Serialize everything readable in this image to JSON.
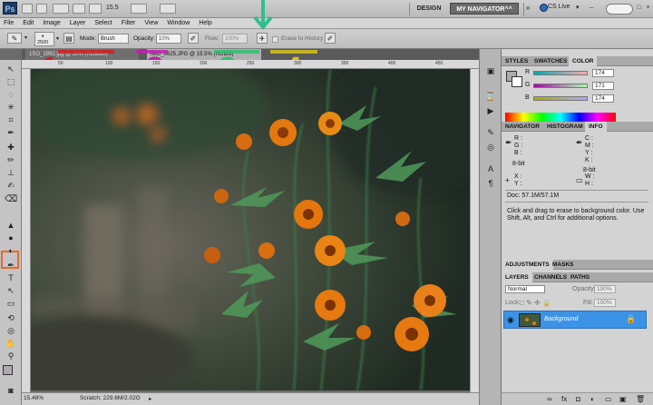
{
  "app": {
    "logo": "Ps",
    "zoom": "15.5",
    "workspace_design": "DESIGN",
    "workspace_active": "MY NAVIGATOR^^",
    "cs_live": "CS Live",
    "win_min": "–",
    "win_max": "□",
    "win_close": "×"
  },
  "menu": [
    "File",
    "Edit",
    "Image",
    "Layer",
    "Select",
    "Filter",
    "View",
    "Window",
    "Help"
  ],
  "options": {
    "brush_size": "2500",
    "mode_label": "Mode:",
    "mode_value": "Brush",
    "opacity_label": "Opacity:",
    "opacity_value": "10%",
    "flow_label": "Flow:",
    "flow_value": "100%",
    "erase_history_label": "Erase to History"
  },
  "tabs": [
    {
      "label": "1SO_1992.jpg @ 50% (RGB/8#)"
    },
    {
      "label": "IMG_0625.JPG @ 15.5% (RGB/8)"
    }
  ],
  "ruler": [
    "50",
    "100",
    "150",
    "200",
    "250",
    "300",
    "350",
    "400",
    "450"
  ],
  "annotations": {
    "n1": {
      "text": "1",
      "color": "#d11f1f"
    },
    "n2": {
      "text": "2",
      "color": "#c21fb0"
    },
    "n3": {
      "text": "3",
      "color": "#2fbf6e"
    },
    "n4": {
      "text": "4",
      "color": "#d8c21a"
    },
    "arrow_color": "#2fbf8e",
    "highlight_color": "#e8692a"
  },
  "status": {
    "zoom": "15.48%",
    "scratch": "Scratch: 229.6M/2.02G"
  },
  "color_panel": {
    "tabs": [
      "STYLES",
      "SWATCHES",
      "COLOR"
    ],
    "r_label": "R",
    "r_value": "174",
    "g_label": "G",
    "g_value": "171",
    "b_label": "B",
    "b_value": "174",
    "fg": "#aeabae"
  },
  "info_panel": {
    "tabs": [
      "NAVIGATOR",
      "HISTOGRAM",
      "INFO"
    ],
    "r": "R :",
    "g": "G :",
    "b": "B :",
    "c": "C :",
    "m": "M :",
    "y": "Y :",
    "k": "K :",
    "bit_left": "8-bit",
    "bit_right": "8-bit",
    "x": "X :",
    "y2": "Y :",
    "w": "W :",
    "h": "H :",
    "doc": "Doc: 57.1M/57.1M",
    "hint": "Click and drag to erase to background color.  Use Shift, Alt, and Ctrl for additional options."
  },
  "adjust_tabs": [
    "ADJUSTMENTS",
    "MASKS"
  ],
  "layers_panel": {
    "tabs": [
      "LAYERS",
      "CHANNELS",
      "PATHS"
    ],
    "blend": "Normal",
    "opacity_label": "Opacity:",
    "opacity_value": "100%",
    "lock_label": "Lock:",
    "fill_label": "Fill:",
    "fill_value": "100%",
    "layer_name": "Background"
  }
}
